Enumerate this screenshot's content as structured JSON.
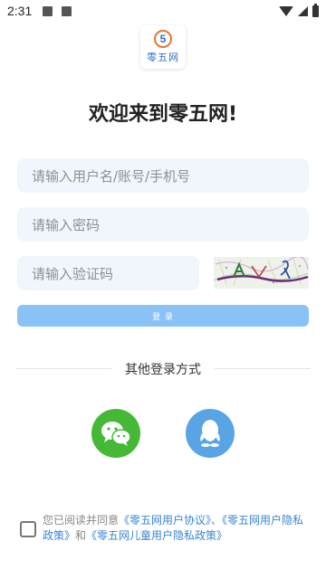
{
  "status_bar": {
    "time": "2:31"
  },
  "logo": {
    "number": "5",
    "text": "零五网"
  },
  "page": {
    "title": "欢迎来到零五网!"
  },
  "form": {
    "username_placeholder": "请输入用户名/账号/手机号",
    "password_placeholder": "请输入密码",
    "captcha_placeholder": "请输入验证码",
    "login_label": "登 录"
  },
  "other_login": {
    "label": "其他登录方式",
    "methods": [
      {
        "name": "wechat",
        "icon": "wechat-icon",
        "color": "#45b936"
      },
      {
        "name": "qq",
        "icon": "qq-icon",
        "color": "#58a4e4"
      }
    ]
  },
  "agreement": {
    "prefix": "您已阅读并同意",
    "link1": "《零五网用户协议》",
    "sep1": "、",
    "link2": "《零五网用户隐私政策》",
    "sep2": "和",
    "link3": "《零五网儿童用户隐私政策》"
  },
  "colors": {
    "accent": "#89c2f6",
    "link": "#3a86d6",
    "input_bg": "#f1f6fd",
    "wechat": "#45b936",
    "qq": "#58a4e4"
  }
}
